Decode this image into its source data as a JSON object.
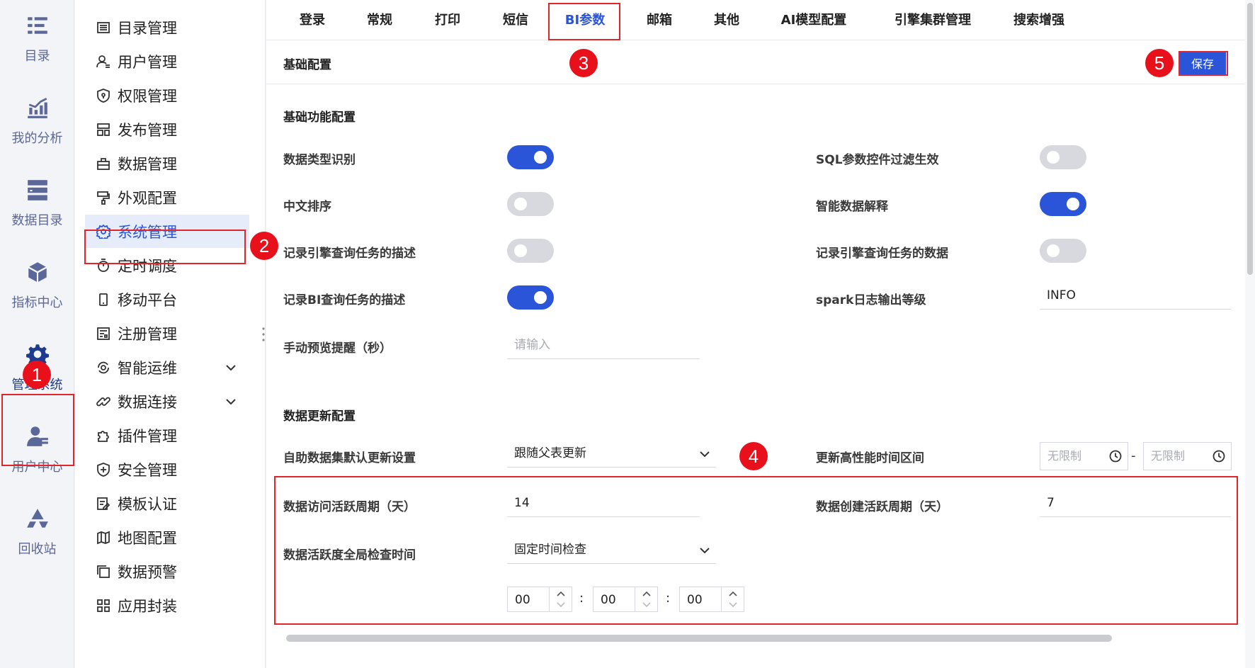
{
  "rail": [
    {
      "label": "目录",
      "icon": "catalog-icon"
    },
    {
      "label": "我的分析",
      "icon": "analysis-icon"
    },
    {
      "label": "数据目录",
      "icon": "data-catalog-icon"
    },
    {
      "label": "指标中心",
      "icon": "metrics-icon"
    },
    {
      "label": "管理系统",
      "icon": "gear-icon"
    },
    {
      "label": "用户中心",
      "icon": "user-center-icon"
    },
    {
      "label": "回收站",
      "icon": "recycle-icon"
    }
  ],
  "nav": [
    {
      "label": "目录管理",
      "icon": "list-icon"
    },
    {
      "label": "用户管理",
      "icon": "user-icon"
    },
    {
      "label": "权限管理",
      "icon": "shield-lock-icon"
    },
    {
      "label": "发布管理",
      "icon": "publish-icon"
    },
    {
      "label": "数据管理",
      "icon": "data-icon"
    },
    {
      "label": "外观配置",
      "icon": "paint-icon"
    },
    {
      "label": "系统管理",
      "icon": "gear-icon"
    },
    {
      "label": "定时调度",
      "icon": "timer-icon"
    },
    {
      "label": "移动平台",
      "icon": "mobile-icon"
    },
    {
      "label": "注册管理",
      "icon": "register-icon"
    },
    {
      "label": "智能运维",
      "icon": "ops-icon"
    },
    {
      "label": "数据连接",
      "icon": "link-icon"
    },
    {
      "label": "插件管理",
      "icon": "puzzle-icon"
    },
    {
      "label": "安全管理",
      "icon": "shield-plus-icon"
    },
    {
      "label": "模板认证",
      "icon": "template-icon"
    },
    {
      "label": "地图配置",
      "icon": "map-icon"
    },
    {
      "label": "数据预警",
      "icon": "alert-icon"
    },
    {
      "label": "应用封装",
      "icon": "app-icon"
    }
  ],
  "tabs": [
    "登录",
    "常规",
    "打印",
    "短信",
    "BI参数",
    "邮箱",
    "其他",
    "AI模型配置",
    "引擎集群管理",
    "搜索增强"
  ],
  "panel": {
    "title": "基础配置",
    "save_label": "保存",
    "basic_group_title": "基础功能配置",
    "data_update_group_title": "数据更新配置"
  },
  "settings": {
    "data_type_detect": {
      "label": "数据类型识别",
      "on": true
    },
    "sql_param_filter": {
      "label": "SQL参数控件过滤生效",
      "on": false
    },
    "chinese_sort": {
      "label": "中文排序",
      "on": false
    },
    "smart_explain": {
      "label": "智能数据解释",
      "on": true
    },
    "log_engine_desc": {
      "label": "记录引擎查询任务的描述",
      "on": false
    },
    "log_engine_data": {
      "label": "记录引擎查询任务的数据",
      "on": false
    },
    "log_bi_desc": {
      "label": "记录BI查询任务的描述",
      "on": true
    },
    "spark_log_level": {
      "label": "spark日志输出等级",
      "value": "INFO"
    },
    "manual_preview": {
      "label": "手动预览提醒（秒）",
      "placeholder": "请输入"
    },
    "self_dataset_update": {
      "label": "自助数据集默认更新设置",
      "value": "跟随父表更新"
    },
    "high_perf_window": {
      "label": "更新高性能时间区间",
      "start_placeholder": "无限制",
      "end_placeholder": "无限制",
      "separator": "-"
    },
    "access_active_period": {
      "label": "数据访问活跃周期（天）",
      "value": "14"
    },
    "create_active_period": {
      "label": "数据创建活跃周期（天）",
      "value": "7"
    },
    "global_check_time": {
      "label": "数据活跃度全局检查时间",
      "value": "固定时间检查"
    },
    "check_time": {
      "hour": "00",
      "minute": "00",
      "second": "00",
      "separator": ":"
    }
  },
  "badges": [
    "1",
    "2",
    "3",
    "4",
    "5"
  ],
  "colors": {
    "accent": "#2a55d8",
    "annotation_red": "#e0262b",
    "toggle_off": "#d7d9de"
  }
}
